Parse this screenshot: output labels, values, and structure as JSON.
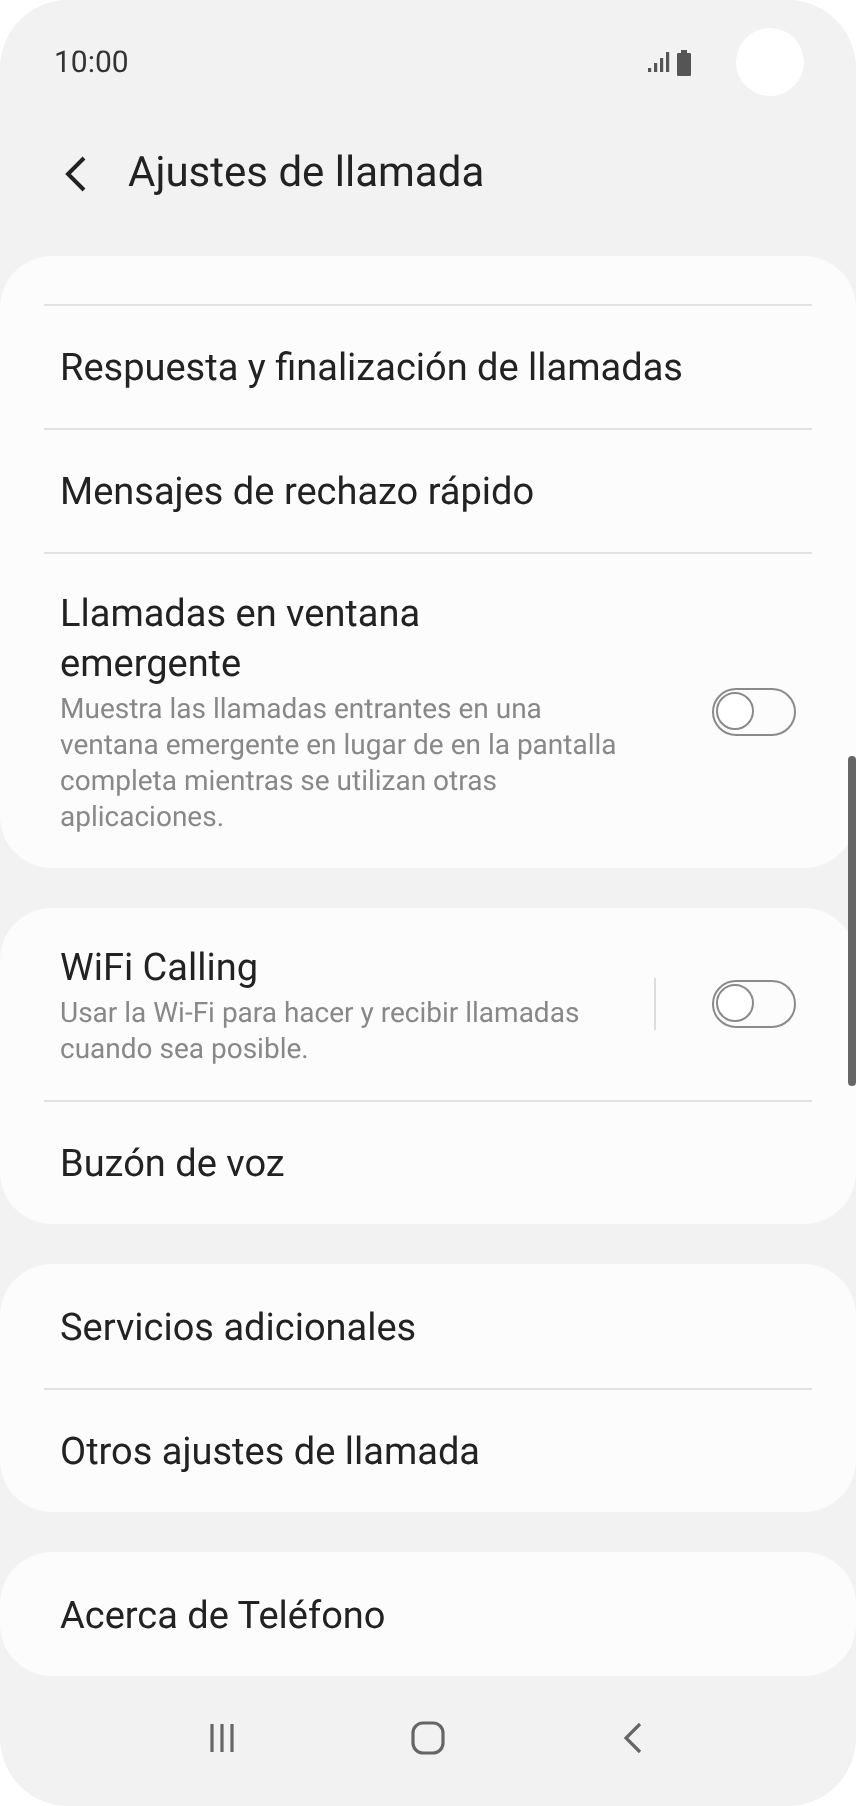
{
  "status_bar": {
    "time": "10:00"
  },
  "header": {
    "title": "Ajustes de llamada"
  },
  "groups": [
    {
      "cut_top": true,
      "items": [
        {
          "kind": "link",
          "title": "Respuesta y finalización de llamadas"
        },
        {
          "kind": "link",
          "title": "Mensajes de rechazo rápido"
        },
        {
          "kind": "toggle",
          "title": "Llamadas en ventana emergente",
          "subtitle": "Muestra las llamadas entrantes en una ventana emergente en lugar de en la pantalla completa mientras se utilizan otras aplicaciones.",
          "on": false,
          "split": false
        }
      ]
    },
    {
      "cut_top": false,
      "items": [
        {
          "kind": "toggle",
          "title": "WiFi Calling",
          "subtitle": "Usar la Wi-Fi para hacer y recibir llamadas cuando sea posible.",
          "on": false,
          "split": true
        },
        {
          "kind": "link",
          "title": "Buzón de voz"
        }
      ]
    },
    {
      "cut_top": false,
      "items": [
        {
          "kind": "link",
          "title": "Servicios adicionales"
        },
        {
          "kind": "link",
          "title": "Otros ajustes de llamada"
        }
      ]
    },
    {
      "cut_top": false,
      "items": [
        {
          "kind": "link",
          "title": "Acerca de Teléfono"
        }
      ]
    }
  ]
}
